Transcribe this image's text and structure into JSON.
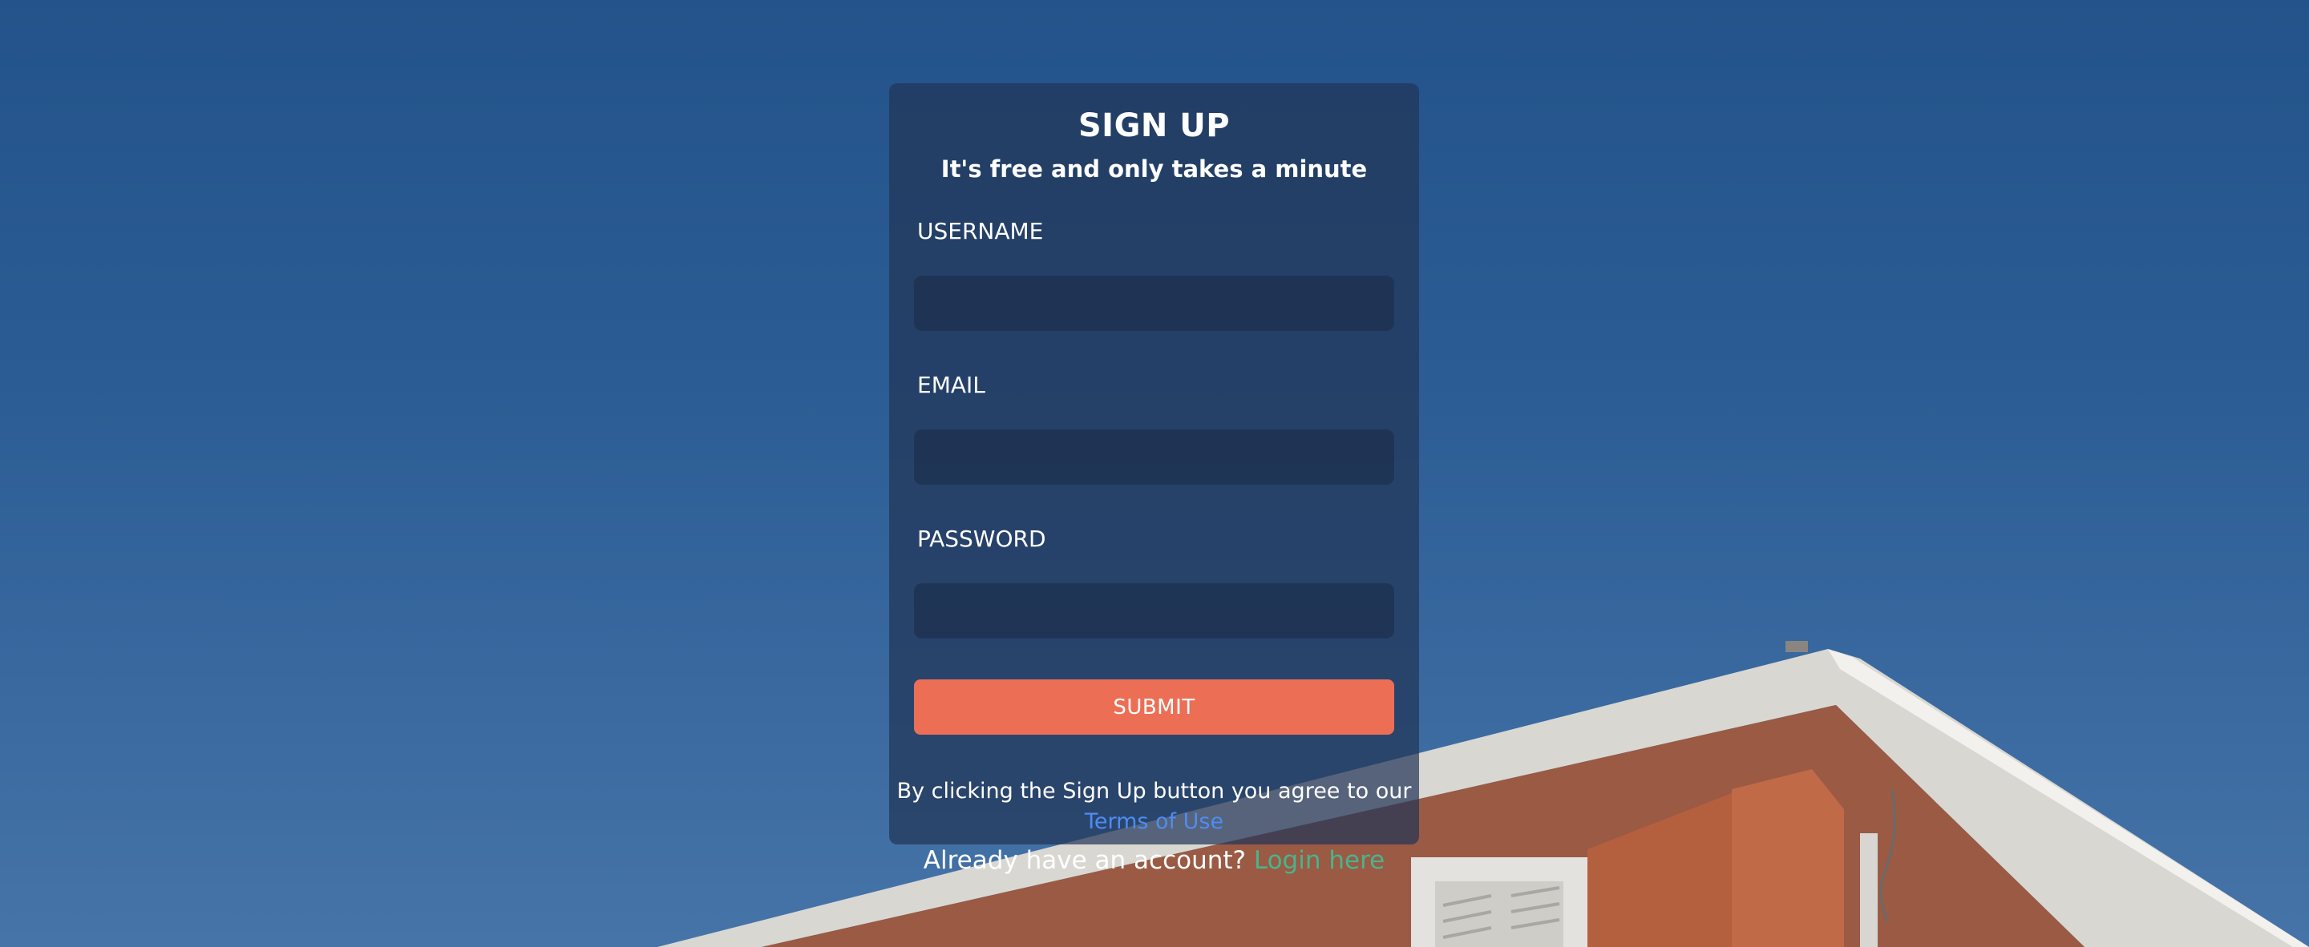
{
  "form": {
    "title": "SIGN UP",
    "subtitle": "It's free and only takes a minute",
    "username_label": "USERNAME",
    "username_value": "",
    "email_label": "EMAIL",
    "email_value": "",
    "password_label": "PASSWORD",
    "password_value": "",
    "submit_label": "SUBMIT",
    "agree_text": "By clicking the Sign Up button you agree to our",
    "terms_link": "Terms of Use"
  },
  "footer": {
    "account_text": "Already have an account?",
    "login_link": "Login here"
  },
  "colors": {
    "accent": "#ec6f55",
    "terms_link": "#4d8df2",
    "login_link": "#49b48d",
    "sky": "#2b5c93"
  }
}
